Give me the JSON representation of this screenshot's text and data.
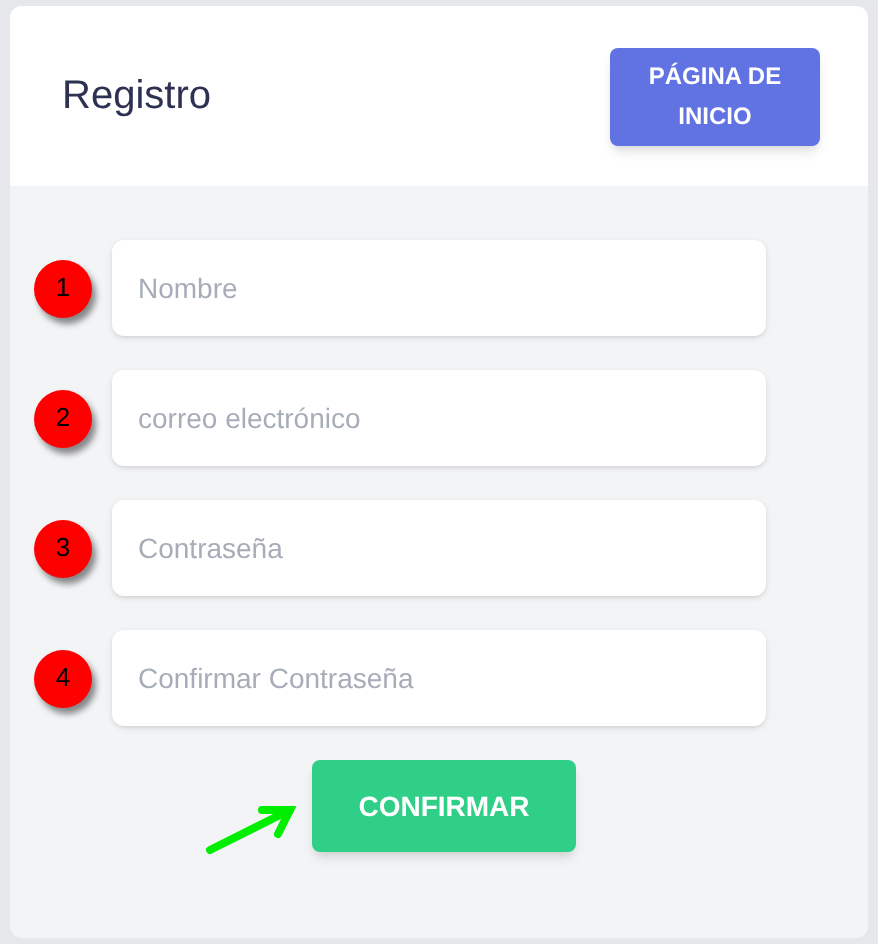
{
  "header": {
    "title": "Registro",
    "home_button": "PÁGINA DE INICIO"
  },
  "fields": [
    {
      "marker": "1",
      "placeholder": "Nombre"
    },
    {
      "marker": "2",
      "placeholder": "correo electrónico"
    },
    {
      "marker": "3",
      "placeholder": "Contraseña"
    },
    {
      "marker": "4",
      "placeholder": "Confirmar Contraseña"
    }
  ],
  "submit_button": "CONFIRMAR"
}
